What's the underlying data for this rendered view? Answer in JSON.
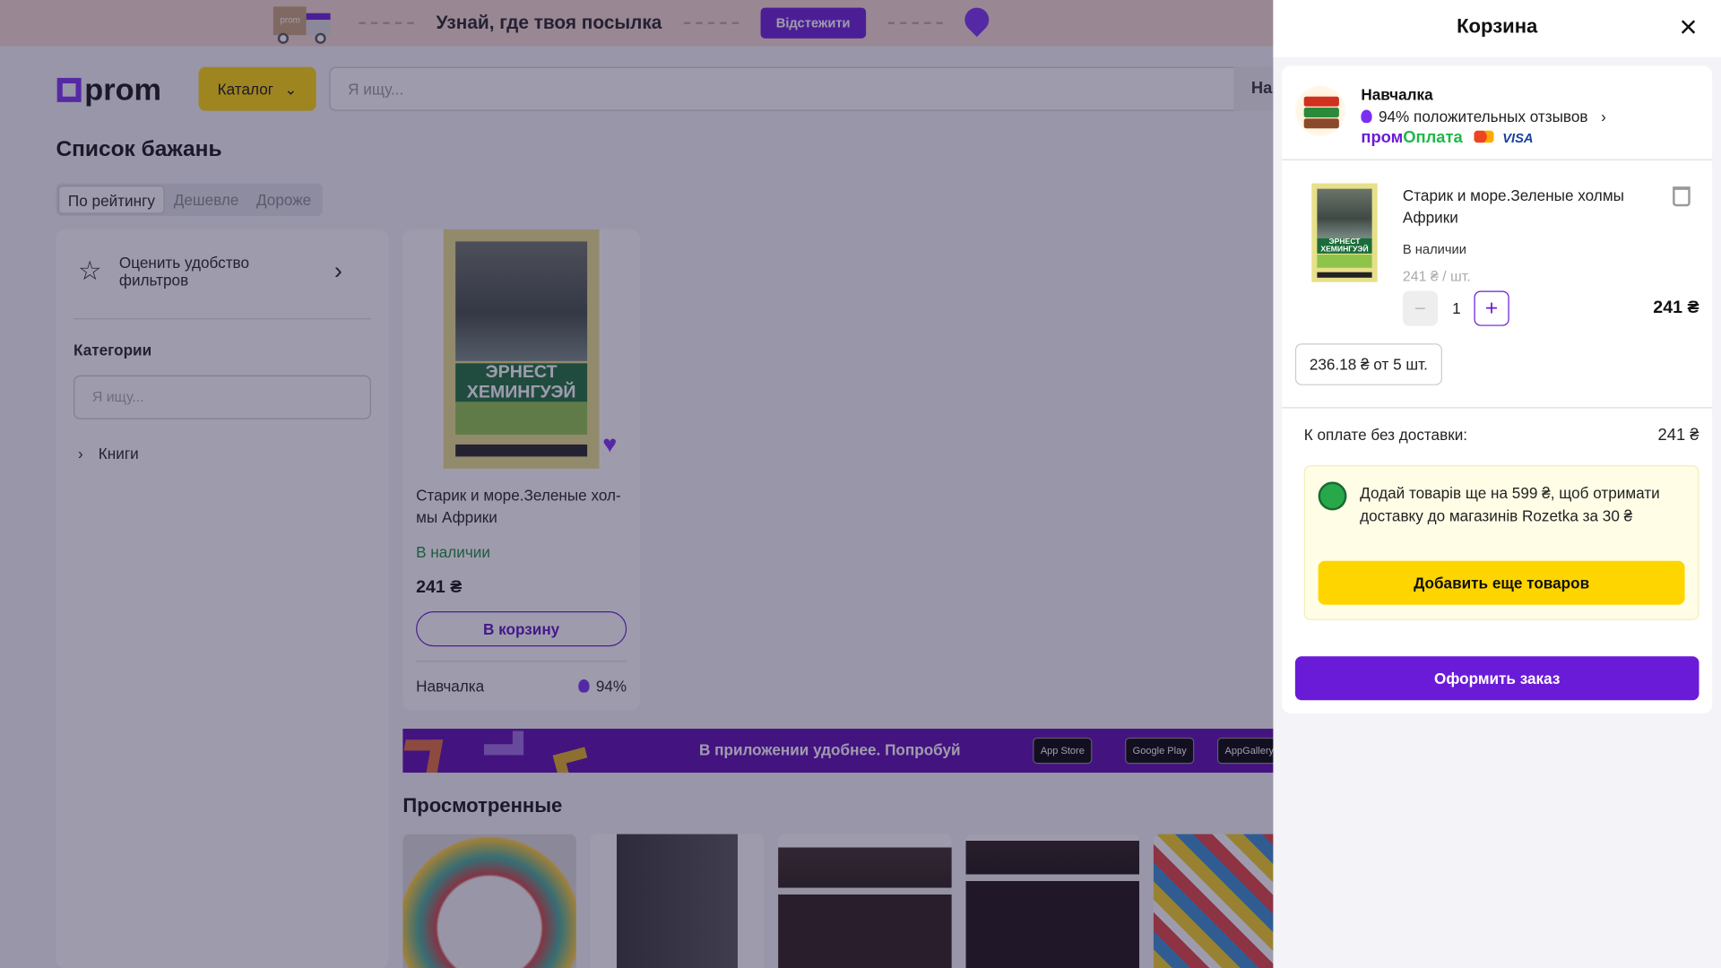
{
  "banner": {
    "text": "Узнай, где твоя посылка",
    "track_button": "Відстежити",
    "truck_label": "prom"
  },
  "header": {
    "logo": "prom",
    "catalog": "Каталог",
    "search_placeholder": "Я ищу...",
    "search_button": "На"
  },
  "page": {
    "title": "Список бажань",
    "sort": [
      "По рейтингу",
      "Дешевле",
      "Дороже"
    ]
  },
  "filters": {
    "rate": "Оценить удобство фильтров",
    "categories_title": "Категории",
    "search_placeholder": "Я ищу...",
    "items": [
      "Книги"
    ]
  },
  "product": {
    "cover_title": "ЭРНЕСТ ХЕМИНГУЭЙ",
    "name": "Старик и море.Зеленые хол-мы Африки",
    "availability": "В наличии",
    "price": "241 ₴",
    "cart_button": "В корзину",
    "seller": "Навчалка",
    "rating": "94%"
  },
  "app_banner": {
    "text": "В приложении удобнее. Попробуй",
    "stores": [
      "App Store",
      "Google Play",
      "AppGallery"
    ]
  },
  "viewed": {
    "title": "Просмотренные"
  },
  "cart": {
    "title": "Корзина",
    "seller": {
      "name": "Навчалка",
      "rating": "94% положительных отзывов",
      "promo_a": "пром",
      "promo_b": "Оплата",
      "visa": "VISA"
    },
    "item": {
      "name": "Старик и море.Зеленые холмы Африки",
      "availability": "В наличии",
      "unit_price": "241 ₴ / шт.",
      "quantity": "1",
      "total": "241 ₴",
      "bulk_price": "236.18 ₴ от 5 шт.",
      "minus": "−",
      "plus": "+"
    },
    "sum_label": "К оплате без доставки:",
    "sum_value": "241 ₴",
    "notice": "Додай товарів ще на 599 ₴, щоб отримати доставку до магазинів Rozetka за 30 ₴",
    "add_more": "Добавить еще товаров",
    "checkout": "Оформить заказ",
    "close": "×"
  },
  "colors": {
    "accent": "#6a1bd8",
    "yellow": "#ffd500",
    "green": "#1a8a3a"
  }
}
